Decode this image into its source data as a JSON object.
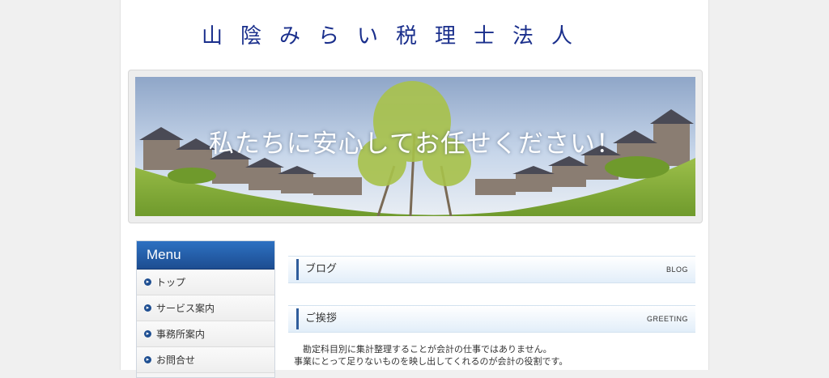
{
  "site": {
    "title": "山陰みらい税理士法人"
  },
  "hero": {
    "caption": "私たちに安心してお任せください！"
  },
  "sidebar": {
    "header": "Menu",
    "items": [
      {
        "label": "トップ"
      },
      {
        "label": "サービス案内"
      },
      {
        "label": "事務所案内"
      },
      {
        "label": "お問合せ"
      }
    ]
  },
  "main": {
    "sections": [
      {
        "title": "ブログ",
        "en": "BLOG"
      },
      {
        "title": "ご挨拶",
        "en": "GREETING"
      }
    ],
    "greeting_lines": [
      "勘定科目別に集計整理することが会計の仕事ではありません。",
      "事業にとって足りないものを映し出してくれるのが会計の役割です。"
    ]
  },
  "colors": {
    "title": "#1a2f8c",
    "menu_header": "#1d4d91",
    "accent": "#2f5d9c",
    "section_bar": "#e2eef9"
  },
  "icons": {
    "menu_bullet": "arrow-bullet-icon"
  }
}
